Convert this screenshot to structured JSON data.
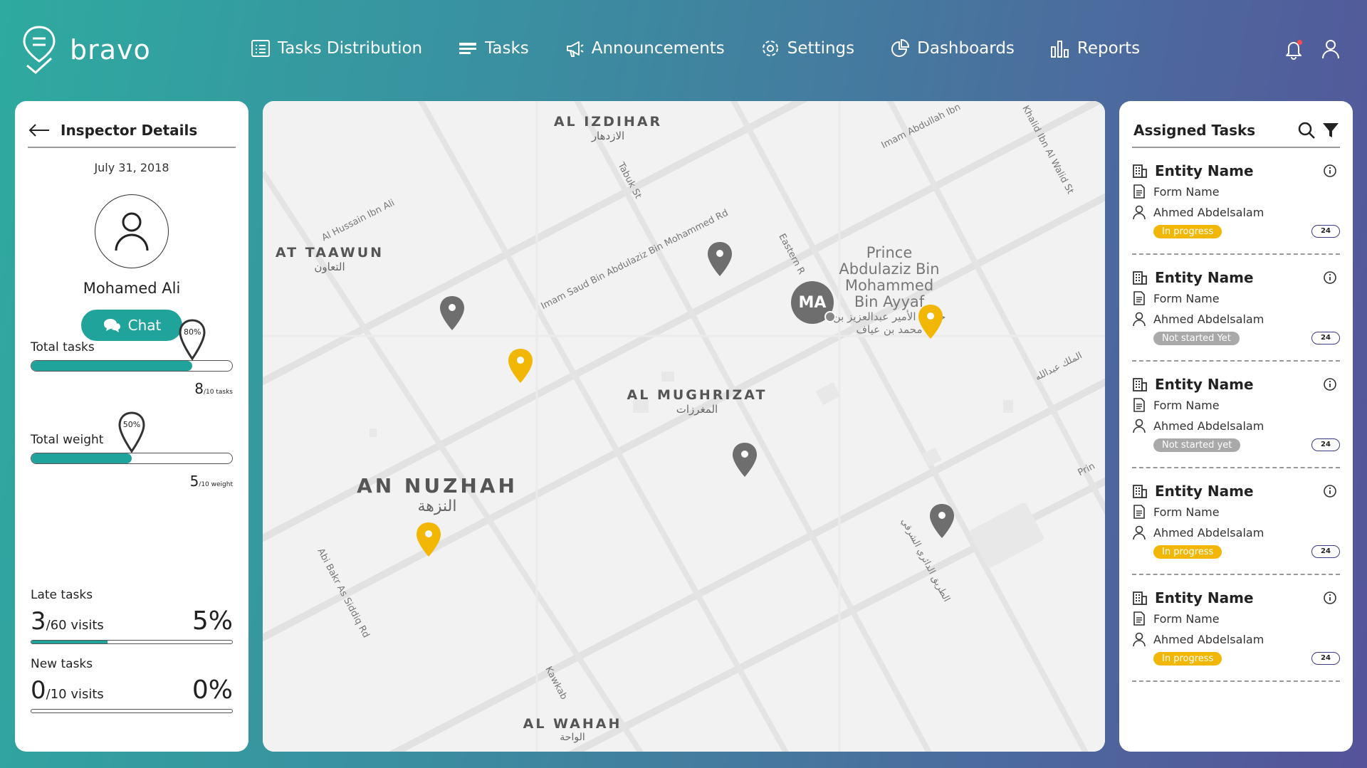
{
  "app": {
    "name": "bravo"
  },
  "nav": [
    {
      "label": "Tasks Distribution",
      "icon": "list-icon"
    },
    {
      "label": "Tasks",
      "icon": "tasks-icon"
    },
    {
      "label": "Announcements",
      "icon": "megaphone-icon"
    },
    {
      "label": "Settings",
      "icon": "gear-icon"
    },
    {
      "label": "Dashboards",
      "icon": "pie-chart-icon"
    },
    {
      "label": "Reports",
      "icon": "bar-chart-icon"
    }
  ],
  "inspector": {
    "title": "Inspector Details",
    "date": "July 31, 2018",
    "name": "Mohamed Ali",
    "chat_label": "Chat",
    "total_tasks": {
      "label": "Total tasks",
      "percent": "80%",
      "value": "8",
      "unit": "/10 tasks",
      "fraction": 0.8
    },
    "total_weight": {
      "label": "Total weight",
      "percent": "50%",
      "value": "5",
      "unit": "/10 weight",
      "fraction": 0.5
    },
    "late_tasks": {
      "label": "Late tasks",
      "value": "3",
      "unit": "/60 visits",
      "percent": "5%",
      "fraction": 0.38
    },
    "new_tasks": {
      "label": "New tasks",
      "value": "0",
      "unit": "/10 visits",
      "percent": "0%",
      "fraction": 0
    }
  },
  "map": {
    "districts": [
      {
        "en": "AL IZDIHAR",
        "ar": "الازدهار"
      },
      {
        "en": "AT TAAWUN",
        "ar": "التعاون"
      },
      {
        "en": "AL MUGHRIZAT",
        "ar": "المغرزات"
      },
      {
        "en": "AN NUZHAH",
        "ar": "النزهة"
      },
      {
        "en": "AL WAHAH",
        "ar": "الواحة"
      }
    ],
    "park": {
      "en": "Prince Abdulaziz Bin Mohammed Bin Ayyaf",
      "ar": "حديقة الأمير عبدالعزيز بن محمد بن عياف"
    },
    "streets": [
      "Imam Saud Bin Abdulaziz Bin Mohammed Rd",
      "Al Hussain Ibn Ali",
      "Imam Abdullah Ibn",
      "Tabuk St",
      "Eastern R",
      "Khalid Ibn Al Walid St",
      "Abi Bakr As Siddiq Rd",
      "Kawkab",
      "الطريق الدائري الشرقي",
      "الملك عبدالله",
      "Prin"
    ],
    "marker_initials": "MA"
  },
  "tasks_panel": {
    "title": "Assigned Tasks",
    "items": [
      {
        "entity": "Entity Name",
        "form": "Form Name",
        "user": "Ahmed Abdelsalam",
        "status": "In progress",
        "status_type": "progress",
        "count": "24"
      },
      {
        "entity": "Entity Name",
        "form": "Form Name",
        "user": "Ahmed Abdelsalam",
        "status": "Not started Yet",
        "status_type": "notstarted",
        "count": "24"
      },
      {
        "entity": "Entity Name",
        "form": "Form Name",
        "user": "Ahmed Abdelsalam",
        "status": "Not started yet",
        "status_type": "notstarted",
        "count": "24"
      },
      {
        "entity": "Entity Name",
        "form": "Form Name",
        "user": "Ahmed Abdelsalam",
        "status": "In progress",
        "status_type": "progress",
        "count": "24"
      },
      {
        "entity": "Entity Name",
        "form": "Form Name",
        "user": "Ahmed Abdelsalam",
        "status": "In progress",
        "status_type": "progress",
        "count": "24"
      }
    ]
  },
  "colors": {
    "accent": "#20a39a",
    "progress": "#f2b705",
    "not_started": "#a9a9a9",
    "pin_gray": "#6e6e6e",
    "pin_yellow": "#f2b705"
  }
}
